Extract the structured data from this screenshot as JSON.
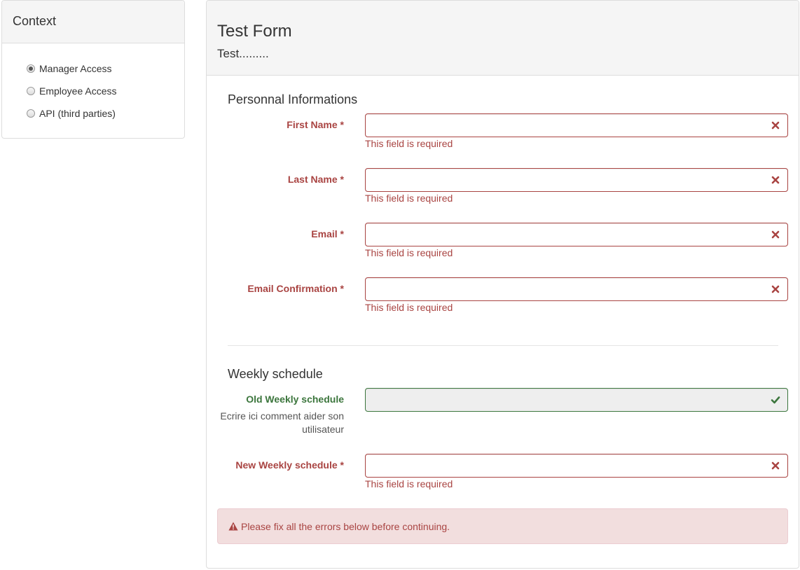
{
  "context": {
    "title": "Context",
    "options": [
      {
        "label": "Manager Access",
        "checked": true
      },
      {
        "label": "Employee Access",
        "checked": false
      },
      {
        "label": "API (third parties)",
        "checked": false
      }
    ]
  },
  "form": {
    "title": "Test Form",
    "subtitle": "Test.........",
    "personal_section": "Personnal Informations",
    "schedule_section": "Weekly schedule",
    "fields": {
      "first_name": {
        "label": "First Name *",
        "value": "",
        "error": "This field is required"
      },
      "last_name": {
        "label": "Last Name *",
        "value": "",
        "error": "This field is required"
      },
      "email": {
        "label": "Email *",
        "value": "",
        "error": "This field is required"
      },
      "email_confirmation": {
        "label": "Email Confirmation *",
        "value": "",
        "error": "This field is required"
      },
      "old_weekly": {
        "label": "Old Weekly schedule",
        "value": "",
        "help": "Ecrire ici comment aider son utilisateur"
      },
      "new_weekly": {
        "label": "New Weekly schedule *",
        "value": "",
        "error": "This field is required"
      }
    },
    "alert": "Please fix all the errors below before continuing."
  },
  "colors": {
    "error": "#a94442",
    "success": "#3c763d",
    "alert_bg": "#f2dede",
    "panel_heading_bg": "#f5f5f5"
  },
  "icons": {
    "error_feedback": "remove-icon",
    "success_feedback": "ok-icon",
    "alert": "warning-triangle-icon",
    "radio": "radio-button"
  }
}
